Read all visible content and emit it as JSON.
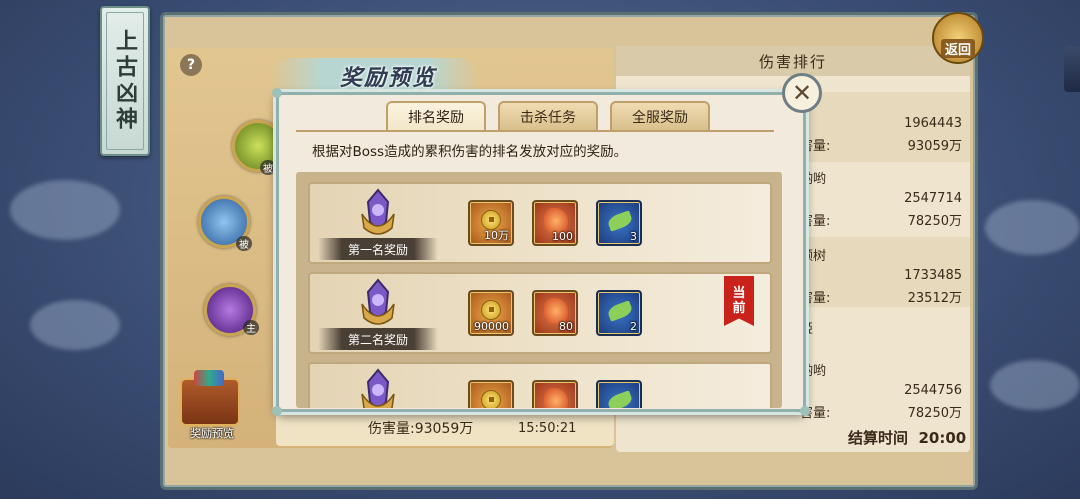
{
  "side_title": "上古凶神",
  "back_button": "返回",
  "help_button": "?",
  "chest_label": "奖励预览",
  "skills": [
    {
      "tag": "被"
    },
    {
      "tag": "被"
    },
    {
      "tag": "主"
    }
  ],
  "bottom_info": {
    "damage": "伤害量:93059万",
    "time": "15:50:21"
  },
  "ranking": {
    "header": "伤害排行",
    "rows": [
      {
        "name": "",
        "score": "1964443",
        "damage_label": "害量:",
        "damage": "93059万"
      },
      {
        "name": "哟哟",
        "score": "2547714",
        "damage_label": "害量:",
        "damage": "78250万"
      },
      {
        "name": "颗树",
        "score": "1733485",
        "damage_label": "害量:",
        "damage": "23512万"
      },
      {
        "name": "姬",
        "score": "",
        "damage_label": "",
        "damage": ""
      },
      {
        "name": "哟哟",
        "score": "2544756",
        "damage_label": "害量:",
        "damage": "78250万"
      }
    ],
    "settle_label": "结算时间",
    "settle_time": "20:00"
  },
  "modal": {
    "title": "奖励预览",
    "close": "✕",
    "tabs": [
      {
        "label": "排名奖励",
        "active": true
      },
      {
        "label": "击杀任务",
        "active": false
      },
      {
        "label": "全服奖励",
        "active": false
      }
    ],
    "description": "根据对Boss造成的累积伤害的排名发放对应的奖励。",
    "current_tag": "当前",
    "rewards": [
      {
        "rank": "第一名奖励",
        "items": [
          {
            "type": "gold",
            "icon": "coin-icon",
            "count": "10万"
          },
          {
            "type": "red",
            "icon": "dragon-icon",
            "count": "100"
          },
          {
            "type": "blue",
            "icon": "leaf-icon",
            "count": "3"
          }
        ]
      },
      {
        "rank": "第二名奖励",
        "items": [
          {
            "type": "gold",
            "icon": "coin-icon",
            "count": "90000"
          },
          {
            "type": "red",
            "icon": "dragon-icon",
            "count": "80"
          },
          {
            "type": "blue",
            "icon": "leaf-icon",
            "count": "2"
          }
        ]
      },
      {
        "rank": "",
        "items": [
          {
            "type": "gold",
            "icon": "coin-icon",
            "count": ""
          },
          {
            "type": "red",
            "icon": "dragon-icon",
            "count": ""
          },
          {
            "type": "blue",
            "icon": "leaf-icon",
            "count": ""
          }
        ]
      }
    ]
  }
}
